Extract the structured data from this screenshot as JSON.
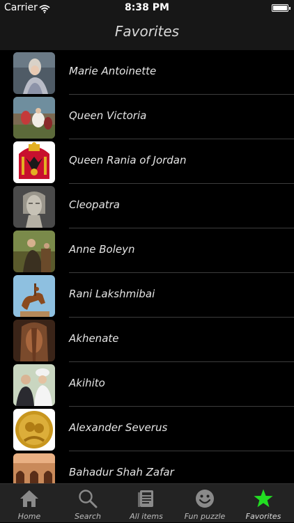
{
  "status": {
    "carrier": "Carrier",
    "time": "8:38 PM"
  },
  "nav": {
    "title": "Favorites"
  },
  "list": [
    {
      "label": "Marie Antoinette"
    },
    {
      "label": "Queen Victoria"
    },
    {
      "label": "Queen Rania of Jordan"
    },
    {
      "label": "Cleopatra"
    },
    {
      "label": "Anne Boleyn"
    },
    {
      "label": "Rani Lakshmibai"
    },
    {
      "label": "Akhenate"
    },
    {
      "label": "Akihito"
    },
    {
      "label": "Alexander Severus"
    },
    {
      "label": "Bahadur Shah Zafar"
    }
  ],
  "tabs": [
    {
      "label": "Home",
      "icon": "home-icon"
    },
    {
      "label": "Search",
      "icon": "search-icon"
    },
    {
      "label": "All items",
      "icon": "book-icon"
    },
    {
      "label": "Fun puzzle",
      "icon": "smiley-icon"
    },
    {
      "label": "Favorites",
      "icon": "star-icon",
      "active": true
    }
  ],
  "colors": {
    "active_tab": "#22dd22",
    "bar_bg": "#171717",
    "tabbar_bg": "#232323"
  }
}
